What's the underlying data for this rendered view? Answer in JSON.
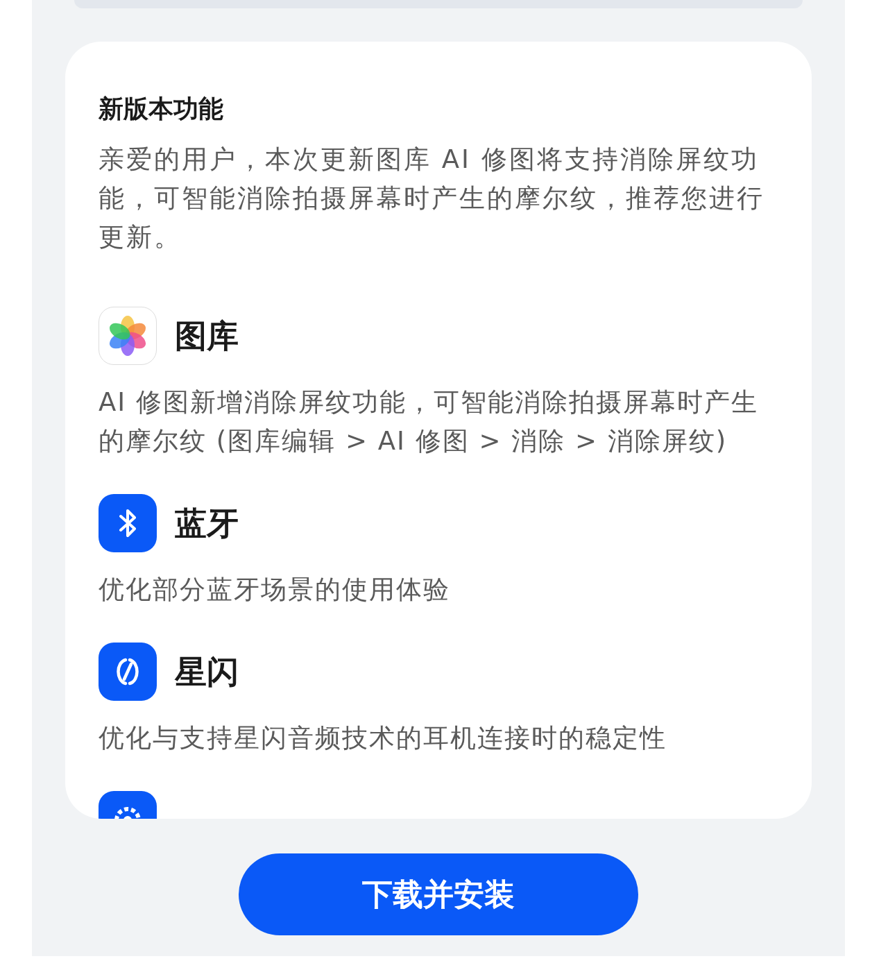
{
  "section_title": "新版本功能",
  "intro": "亲爱的用户，本次更新图库 AI 修图将支持消除屏纹功能，可智能消除拍摄屏幕时产生的摩尔纹，推荐您进行更新。",
  "features": [
    {
      "kind": "gallery",
      "name": "图库",
      "description": "AI 修图新增消除屏纹功能，可智能消除拍摄屏幕时产生的摩尔纹 (图库编辑 > AI 修图 > 消除 > 消除屏纹)"
    },
    {
      "kind": "bluetooth",
      "name": "蓝牙",
      "description": "优化部分蓝牙场景的使用体验"
    },
    {
      "kind": "starflash",
      "name": "星闪",
      "description": "优化与支持星闪音频技术的耳机连接时的稳定性"
    },
    {
      "kind": "settings"
    }
  ],
  "button": "下载并安装"
}
